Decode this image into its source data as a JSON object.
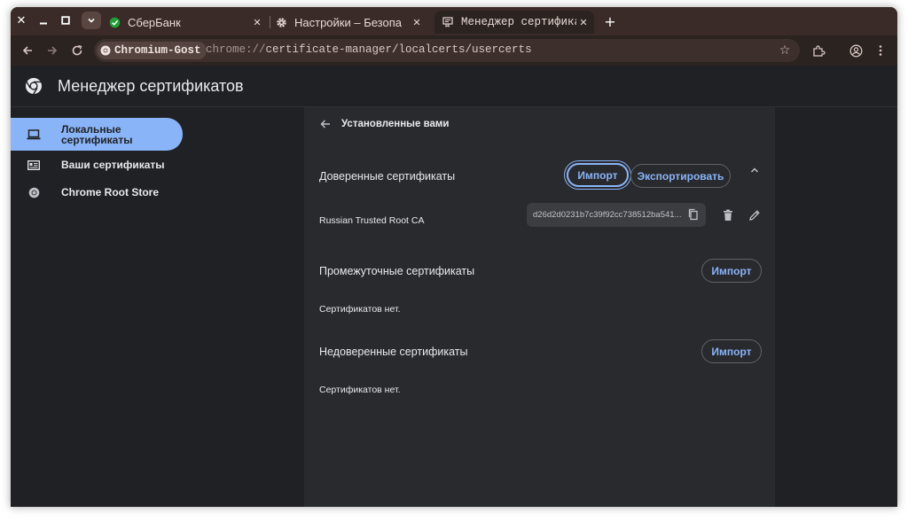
{
  "colors": {
    "tabstrip_bg": "#3b2b28",
    "toolbar_bg": "#2b2320",
    "page_bg": "#202124",
    "main_panel_bg": "#292a2d",
    "accent": "#8ab4f8"
  },
  "window_controls": {
    "close_icon": "close-icon",
    "minimize_icon": "minimize-icon",
    "maximize_icon": "maximize-icon",
    "tab_search_icon": "chevron-down-icon"
  },
  "tabs": [
    {
      "title": "СберБанк",
      "icon": "sber-favicon",
      "close": "✕"
    },
    {
      "title": "Настройки – Безопа",
      "icon": "gear-icon",
      "close": "✕"
    },
    {
      "title": "Менеджер сертифика",
      "icon": "certificate-icon",
      "close": "✕",
      "active": true
    }
  ],
  "new_tab_label": "+",
  "toolbar": {
    "site_chip": "Chromium-Gost",
    "url_scheme": "chrome://",
    "url_rest": "certificate-manager/localcerts/usercerts"
  },
  "page": {
    "title": "Менеджер сертификатов"
  },
  "sidebar": {
    "items": [
      {
        "label": "Локальные сертификаты",
        "icon": "laptop-icon",
        "selected": true
      },
      {
        "label": "Ваши сертификаты",
        "icon": "id-card-icon",
        "selected": false
      },
      {
        "label": "Chrome Root Store",
        "icon": "chrome-icon",
        "selected": false
      }
    ]
  },
  "main": {
    "section_title": "Установленные вами",
    "trusted": {
      "label": "Доверенные сертификаты",
      "import_label": "Импорт",
      "export_label": "Экспортировать",
      "certificate": {
        "name": "Russian Trusted Root CA",
        "hash": "d26d2d0231b7c39f92cc738512ba541..."
      }
    },
    "intermediate": {
      "label": "Промежуточные сертификаты",
      "import_label": "Импорт",
      "empty_text": "Сертификатов нет."
    },
    "untrusted": {
      "label": "Недоверенные сертификаты",
      "import_label": "Импорт",
      "empty_text": "Сертификатов нет."
    }
  }
}
